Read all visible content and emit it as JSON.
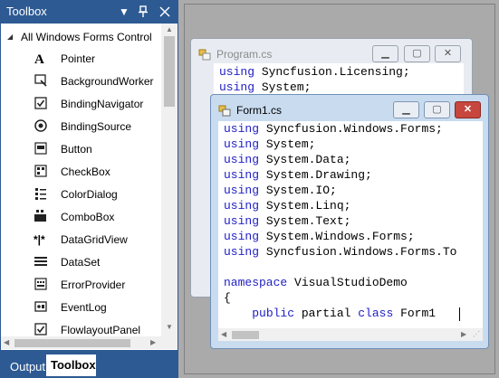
{
  "toolbox": {
    "title": "Toolbox",
    "group_label": "All Windows Forms Control",
    "items": [
      {
        "label": "Pointer",
        "icon": "pointer-icon"
      },
      {
        "label": "BackgroundWorker",
        "icon": "background-worker-icon"
      },
      {
        "label": "BindingNavigator",
        "icon": "binding-navigator-icon"
      },
      {
        "label": "BindingSource",
        "icon": "binding-source-icon"
      },
      {
        "label": "Button",
        "icon": "button-icon"
      },
      {
        "label": "CheckBox",
        "icon": "checkbox-icon"
      },
      {
        "label": "ColorDialog",
        "icon": "color-dialog-icon"
      },
      {
        "label": "ComboBox",
        "icon": "combobox-icon"
      },
      {
        "label": "DataGridView",
        "icon": "datagridview-icon"
      },
      {
        "label": "DataSet",
        "icon": "dataset-icon"
      },
      {
        "label": "ErrorProvider",
        "icon": "error-provider-icon"
      },
      {
        "label": "EventLog",
        "icon": "eventlog-icon"
      },
      {
        "label": "FlowlayoutPanel",
        "icon": "flowlayout-panel-icon"
      }
    ],
    "tabs": {
      "output": "Output",
      "toolbox": "Toolbox"
    }
  },
  "program_window": {
    "title": "Program.cs",
    "lines": [
      [
        {
          "k": "using"
        },
        {
          "t": " Syncfusion.Licensing;"
        }
      ],
      [
        {
          "k": "using"
        },
        {
          "t": " System;"
        }
      ]
    ]
  },
  "form1_window": {
    "title": "Form1.cs",
    "lines": [
      [
        {
          "k": "using"
        },
        {
          "t": " Syncfusion.Windows.Forms;"
        }
      ],
      [
        {
          "k": "using"
        },
        {
          "t": " System;"
        }
      ],
      [
        {
          "k": "using"
        },
        {
          "t": " System.Data;"
        }
      ],
      [
        {
          "k": "using"
        },
        {
          "t": " System.Drawing;"
        }
      ],
      [
        {
          "k": "using"
        },
        {
          "t": " System.IO;"
        }
      ],
      [
        {
          "k": "using"
        },
        {
          "t": " System.Linq;"
        }
      ],
      [
        {
          "k": "using"
        },
        {
          "t": " System.Text;"
        }
      ],
      [
        {
          "k": "using"
        },
        {
          "t": " System.Windows.Forms;"
        }
      ],
      [
        {
          "k": "using"
        },
        {
          "t": " Syncfusion.Windows.Forms.To"
        }
      ],
      [],
      [
        {
          "k": "namespace"
        },
        {
          "t": " VisualStudioDemo"
        }
      ],
      [
        {
          "t": "{"
        }
      ],
      [
        {
          "t": "    "
        },
        {
          "k": "public"
        },
        {
          "t": " partial "
        },
        {
          "k": "class"
        },
        {
          "t": " Form1 "
        }
      ],
      [
        {
          "t": "    "
        }
      ]
    ]
  },
  "colors": {
    "toolbox_frame": "#2d5a93",
    "keyword": "#1d1dc4",
    "close_button": "#c7463d"
  }
}
